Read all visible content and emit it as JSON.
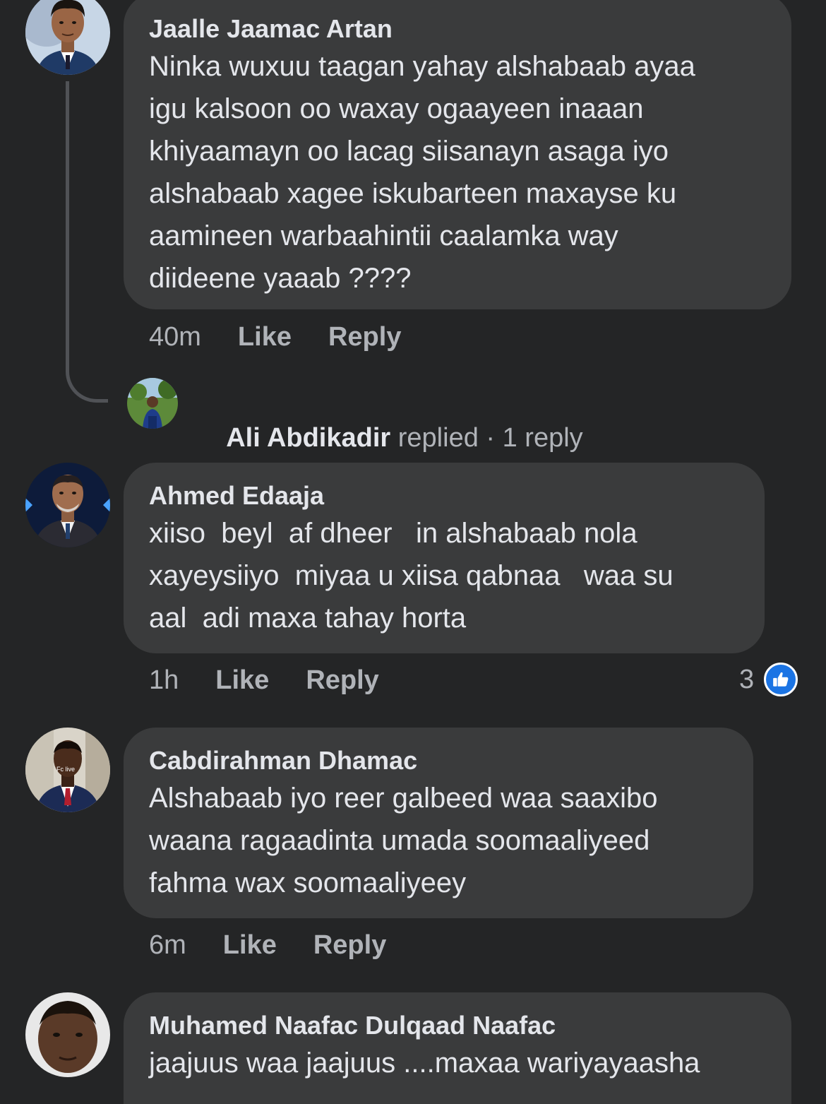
{
  "comments": [
    {
      "author": "Jaalle Jaamac Artan",
      "lines": [
        "Ninka wuxuu taagan yahay alshabaab ayaa",
        "igu kalsoon oo waxay ogaayeen inaaan",
        "khiyaamayn oo lacag siisanayn asaga iyo",
        "alshabaab xagee iskubarteen maxayse ku",
        "aamineen warbaahintii caalamka way",
        "diideene yaaab ????"
      ],
      "time": "40m",
      "like_label": "Like",
      "reply_label": "Reply",
      "replies": {
        "name": "Ali Abdikadir",
        "replied_text": " replied",
        "count_text": " · 1 reply"
      }
    },
    {
      "author": "Ahmed Edaaja",
      "lines": [
        "xiiso  beyl  af dheer   in alshabaab nola",
        "xayeysiiyo  miyaa u xiisa qabnaa   waa su",
        "aal  adi maxa tahay horta"
      ],
      "time": "1h",
      "like_label": "Like",
      "reply_label": "Reply",
      "reaction_count": "3"
    },
    {
      "author": "Cabdirahman Dhamac",
      "avatar_overlay_text": "Fc live",
      "lines": [
        "Alshabaab iyo reer galbeed waa saaxibo",
        "waana ragaadinta umada soomaaliyeed",
        "fahma wax soomaaliyeey"
      ],
      "time": "6m",
      "like_label": "Like",
      "reply_label": "Reply"
    },
    {
      "author": "Muhamed Naafac Dulqaad Naafac",
      "lines": [
        "jaajuus waa jaajuus ....maxaa wariyayaasha"
      ]
    }
  ],
  "colors": {
    "background": "#242526",
    "bubble": "#3a3b3c",
    "text_primary": "#e4e6eb",
    "text_secondary": "#b0b3b8",
    "like_blue": "#1b74e4"
  },
  "icons": {
    "reaction": "thumbs-up-icon"
  }
}
